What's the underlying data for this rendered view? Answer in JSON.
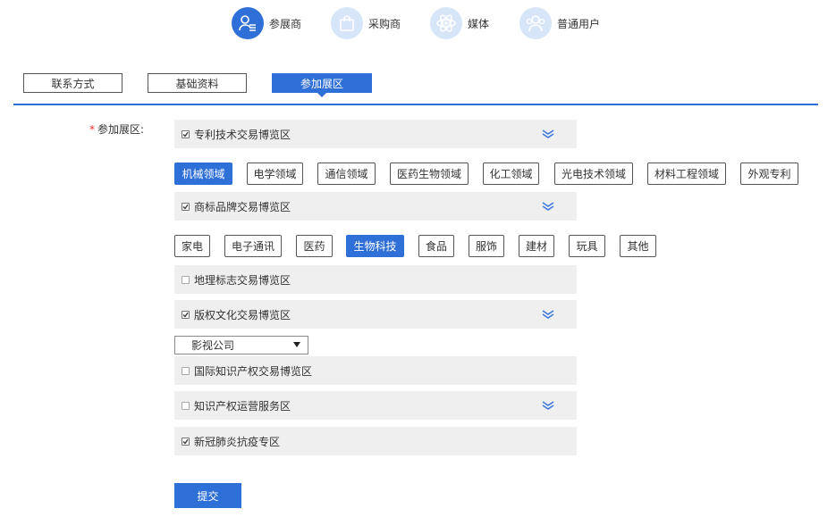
{
  "roles": [
    {
      "label": "参展商",
      "icon": "exhibitor-icon",
      "active": true
    },
    {
      "label": "采购商",
      "icon": "shopping-bag-icon",
      "active": false
    },
    {
      "label": "媒体",
      "icon": "atom-icon",
      "active": false
    },
    {
      "label": "普通用户",
      "icon": "users-icon",
      "active": false
    }
  ],
  "steps": [
    "联系方式",
    "基础资料",
    "参加展区"
  ],
  "active_step": "参加展区",
  "form": {
    "required_mark": "*",
    "label": "参加展区:",
    "zones": [
      {
        "name": "专利技术交易博览区",
        "checked": true,
        "expandable": true
      },
      {
        "name": "商标品牌交易博览区",
        "checked": true,
        "expandable": true
      },
      {
        "name": "地理标志交易博览区",
        "checked": false,
        "expandable": false
      },
      {
        "name": "版权文化交易博览区",
        "checked": true,
        "expandable": true
      },
      {
        "name": "国际知识产权交易博览区",
        "checked": false,
        "expandable": false
      },
      {
        "name": "知识产权运营服务区",
        "checked": false,
        "expandable": true
      },
      {
        "name": "新冠肺炎抗疫专区",
        "checked": true,
        "expandable": false
      }
    ],
    "patent_chips": [
      "机械领域",
      "电学领域",
      "通信领域",
      "医药生物领域",
      "化工领域",
      "光电技术领域",
      "材料工程领域",
      "外观专利"
    ],
    "patent_selected": "机械领域",
    "trademark_chips": [
      "家电",
      "电子通讯",
      "医药",
      "生物科技",
      "食品",
      "服饰",
      "建材",
      "玩具",
      "其他"
    ],
    "trademark_selected": "生物科技",
    "copyright_select": {
      "value": "影视公司"
    },
    "submit_label": "提交"
  },
  "colors": {
    "accent": "#2f6fd8",
    "accent_light": "#d7e5f8",
    "zone_bg": "#efefef",
    "required": "#e33333"
  }
}
